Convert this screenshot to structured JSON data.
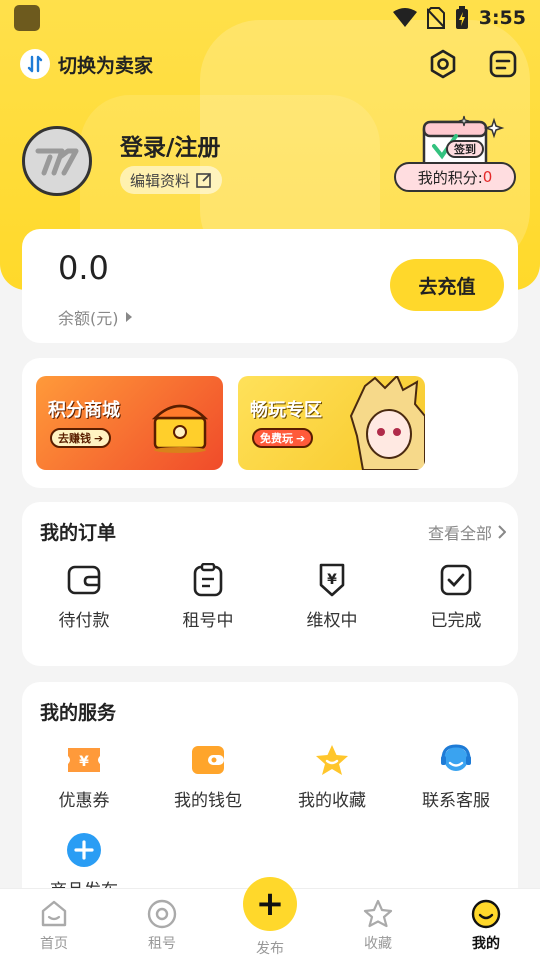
{
  "status_bar": {
    "time": "3:55"
  },
  "header": {
    "switch_label": "切换为卖家"
  },
  "profile": {
    "login_text": "登录/注册",
    "edit_label": "编辑资料",
    "checkin_label": "签到",
    "points_label": "我的积分:",
    "points_value": "0"
  },
  "balance": {
    "value": "0.0",
    "label": "余额(元)",
    "recharge_label": "去充值"
  },
  "banners": [
    {
      "title": "积分商城",
      "cta": "去赚钱"
    },
    {
      "title": "畅玩专区",
      "cta": "免费玩"
    }
  ],
  "orders": {
    "title": "我的订单",
    "view_all": "查看全部",
    "items": [
      {
        "label": "待付款",
        "icon": "wallet-outline-icon"
      },
      {
        "label": "租号中",
        "icon": "clipboard-icon"
      },
      {
        "label": "维权中",
        "icon": "yen-shield-icon"
      },
      {
        "label": "已完成",
        "icon": "check-box-icon"
      }
    ]
  },
  "services": {
    "title": "我的服务",
    "items": [
      {
        "label": "优惠券",
        "icon": "coupon-icon"
      },
      {
        "label": "我的钱包",
        "icon": "wallet-icon"
      },
      {
        "label": "我的收藏",
        "icon": "star-icon"
      },
      {
        "label": "联系客服",
        "icon": "headset-icon"
      }
    ],
    "publish_label": "商品发布"
  },
  "tabbar": {
    "items": [
      {
        "label": "首页",
        "icon": "home-icon"
      },
      {
        "label": "租号",
        "icon": "disc-icon"
      },
      {
        "label": "发布",
        "icon": "plus-icon"
      },
      {
        "label": "收藏",
        "icon": "star-outline-icon"
      },
      {
        "label": "我的",
        "icon": "smile-icon"
      }
    ],
    "active": "我的"
  },
  "colors": {
    "accent": "#ffd82b",
    "header_bg": "#ffe04b",
    "price_red": "#e52828"
  }
}
